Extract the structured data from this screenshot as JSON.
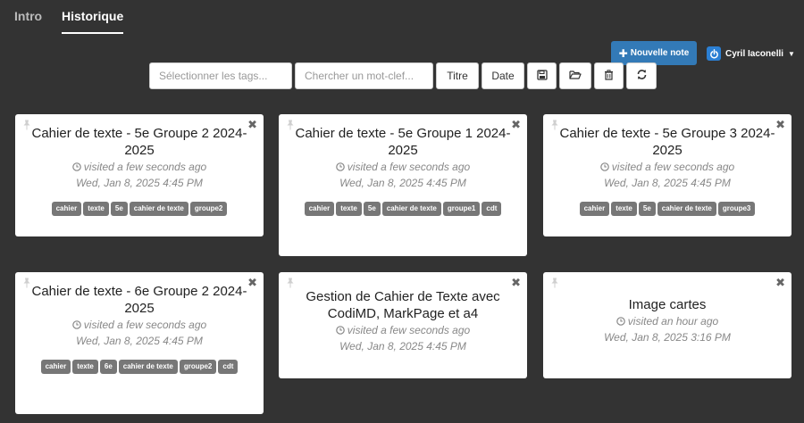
{
  "tabs": [
    {
      "label": "Intro",
      "active": false
    },
    {
      "label": "Historique",
      "active": true
    }
  ],
  "header": {
    "new_note_label": "Nouvelle note",
    "user_name": "Cyril Iaconelli"
  },
  "toolbar": {
    "tags_placeholder": "Sélectionner les tags...",
    "search_placeholder": "Chercher un mot-clef...",
    "title_button": "Titre",
    "date_button": "Date",
    "icons": [
      "save-icon",
      "folder-open-icon",
      "trash-icon",
      "refresh-icon"
    ]
  },
  "notes": [
    {
      "title": "Cahier de texte - 5e Groupe 2 2024-2025",
      "visited": "visited a few seconds ago",
      "date": "Wed, Jan 8, 2025 4:45 PM",
      "tags": [
        "cahier",
        "texte",
        "5e",
        "cahier de texte",
        "groupe2"
      ]
    },
    {
      "title": "Cahier de texte - 5e Groupe 1 2024-2025",
      "visited": "visited a few seconds ago",
      "date": "Wed, Jan 8, 2025 4:45 PM",
      "tags": [
        "cahier",
        "texte",
        "5e",
        "cahier de texte",
        "groupe1",
        "cdt"
      ]
    },
    {
      "title": "Cahier de texte - 5e Groupe 3 2024-2025",
      "visited": "visited a few seconds ago",
      "date": "Wed, Jan 8, 2025 4:45 PM",
      "tags": [
        "cahier",
        "texte",
        "5e",
        "cahier de texte",
        "groupe3"
      ]
    },
    {
      "title": "Cahier de texte - 6e Groupe 2 2024-2025",
      "visited": "visited a few seconds ago",
      "date": "Wed, Jan 8, 2025 4:45 PM",
      "tags": [
        "cahier",
        "texte",
        "6e",
        "cahier de texte",
        "groupe2",
        "cdt"
      ]
    },
    {
      "title": "Gestion de Cahier de Texte avec CodiMD, MarkPage et a4",
      "visited": "visited a few seconds ago",
      "date": "Wed, Jan 8, 2025 4:45 PM",
      "tags": []
    },
    {
      "title": "Image cartes",
      "visited": "visited an hour ago",
      "date": "Wed, Jan 8, 2025 3:16 PM",
      "tags": []
    }
  ],
  "colors": {
    "background": "#333333",
    "primary": "#337ab7",
    "tag": "#777777"
  }
}
